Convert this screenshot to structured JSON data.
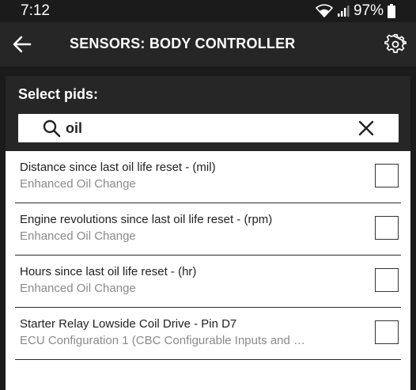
{
  "status_bar": {
    "time": "7:12",
    "battery": "97%"
  },
  "app_bar": {
    "title": "SENSORS: BODY CONTROLLER"
  },
  "dialog": {
    "title": "Select pids:",
    "search": {
      "value": "oil"
    },
    "items": [
      {
        "name": "Distance since last oil life reset - (mil)",
        "category": "Enhanced Oil Change",
        "checked": false
      },
      {
        "name": "Engine revolutions since last oil life reset - (rpm)",
        "category": "Enhanced Oil Change",
        "checked": false
      },
      {
        "name": "Hours since last oil life reset - (hr)",
        "category": "Enhanced Oil Change",
        "checked": false
      },
      {
        "name": "Starter Relay Lowside Coil Drive - Pin D7",
        "category": "ECU Configuration 1 (CBC Configurable Inputs and …",
        "checked": false
      }
    ]
  },
  "colors": {
    "header_bg": "#262626",
    "status_bg": "#1b1b1b",
    "list_bg": "#ffffff",
    "secondary_text": "#8a8a8a"
  },
  "icons": [
    "back-arrow-icon",
    "gear-icon",
    "search-icon",
    "close-icon",
    "wifi-icon",
    "signal-icon",
    "battery-icon"
  ]
}
